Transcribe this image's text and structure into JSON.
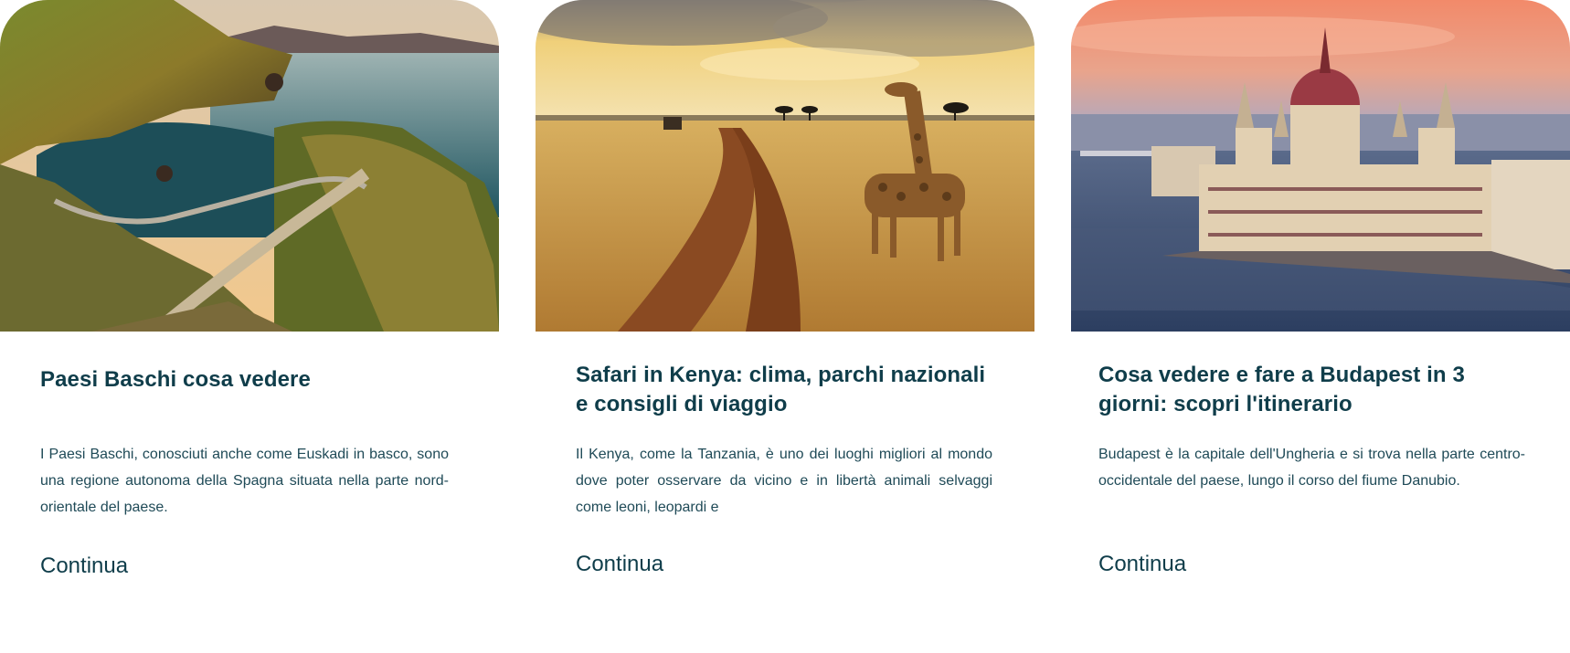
{
  "articles": [
    {
      "image_subject": "Basque coastline with winding stone stairway over a cliff at sunset",
      "title": "Paesi Baschi cosa vedere",
      "excerpt": "I Paesi Baschi, conosciuti anche come Euskadi in basco, sono una regione autonoma della Spagna situata nella parte nord-orientale del paese.",
      "link_label": "Continua"
    },
    {
      "image_subject": "Giraffes beside a dirt track in golden savanna",
      "title": "Safari in Kenya: clima, parchi nazionali e consigli di viaggio",
      "excerpt": "Il Kenya, come la Tanzania, è uno dei luoghi migliori al mondo dove poter osservare da vicino e in libertà animali selvaggi come leoni, leopardi e",
      "link_label": "Continua"
    },
    {
      "image_subject": "Hungarian Parliament on the Danube at sunset",
      "title": "Cosa vedere e fare a Budapest in 3 giorni: scopri l'itinerario",
      "excerpt": "Budapest è la capitale dell'Ungheria e si trova nella parte centro-occidentale del paese, lungo il corso del fiume Danubio.",
      "link_label": "Continua"
    }
  ],
  "colors": {
    "text_primary": "#0f3d4a",
    "text_body": "#1f4a57",
    "background": "#ffffff"
  }
}
